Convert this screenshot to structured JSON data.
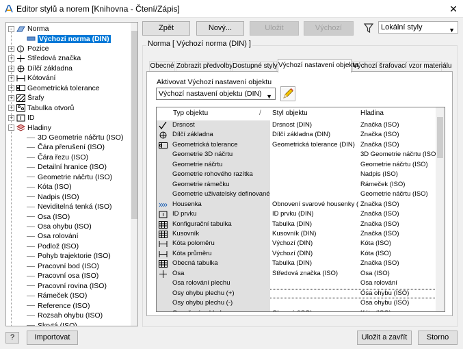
{
  "window": {
    "title": "Editor stylů a norem [Knihovna - Čtení/Zápis]",
    "close": "✕"
  },
  "tree": [
    {
      "label": "Norma",
      "level": 0,
      "exp": "-",
      "icon": "norm"
    },
    {
      "label": "Výchozí norma (DIN)",
      "level": 1,
      "icon": "norm-child",
      "selected": true
    },
    {
      "label": "Pozice",
      "level": 0,
      "exp": "+",
      "icon": "balloon"
    },
    {
      "label": "Středová značka",
      "level": 0,
      "exp": "+",
      "icon": "centermark"
    },
    {
      "label": "Dílčí základna",
      "level": 0,
      "exp": "+",
      "icon": "datum"
    },
    {
      "label": "Kótování",
      "level": 0,
      "exp": "+",
      "icon": "dimension"
    },
    {
      "label": "Geometrická tolerance",
      "level": 0,
      "exp": "+",
      "icon": "gtol"
    },
    {
      "label": "Šrafy",
      "level": 0,
      "exp": "+",
      "icon": "hatch"
    },
    {
      "label": "Tabulka otvorů",
      "level": 0,
      "exp": "+",
      "icon": "holetable"
    },
    {
      "label": "ID",
      "level": 0,
      "exp": "+",
      "icon": "id"
    },
    {
      "label": "Hladiny",
      "level": 0,
      "exp": "-",
      "icon": "layers"
    },
    {
      "label": "3D Geometrie náčrtu (ISO)",
      "level": 1
    },
    {
      "label": "Čára přerušení (ISO)",
      "level": 1
    },
    {
      "label": "Čára řezu (ISO)",
      "level": 1
    },
    {
      "label": "Detailní hranice (ISO)",
      "level": 1
    },
    {
      "label": "Geometrie náčrtu (ISO)",
      "level": 1
    },
    {
      "label": "Kóta (ISO)",
      "level": 1
    },
    {
      "label": "Nadpis (ISO)",
      "level": 1
    },
    {
      "label": "Neviditelná tenká (ISO)",
      "level": 1
    },
    {
      "label": "Osa (ISO)",
      "level": 1
    },
    {
      "label": "Osa ohybu (ISO)",
      "level": 1
    },
    {
      "label": "Osa rolování",
      "level": 1
    },
    {
      "label": "Podlož (ISO)",
      "level": 1
    },
    {
      "label": "Pohyb trajektorie (ISO)",
      "level": 1
    },
    {
      "label": "Pracovní bod (ISO)",
      "level": 1
    },
    {
      "label": "Pracovní osa (ISO)",
      "level": 1
    },
    {
      "label": "Pracovní rovina (ISO)",
      "level": 1
    },
    {
      "label": "Rámeček (ISO)",
      "level": 1
    },
    {
      "label": "Reference (ISO)",
      "level": 1
    },
    {
      "label": "Rozsah ohybu (ISO)",
      "level": 1
    },
    {
      "label": "Skrytá (ISO)",
      "level": 1
    }
  ],
  "toolbar": {
    "back": "Zpět",
    "new": "Nový...",
    "save": "Uložit",
    "default": "Výchozí",
    "filter": "Lokální styly"
  },
  "group_title": "Norma [ Výchozí norma (DIN) ]",
  "tabs": [
    "Obecné",
    "Zobrazit předvolby",
    "Dostupné styly",
    "Výchozí nastavení objektu",
    "Výchozí šrafovací vzor materiálu"
  ],
  "active_tab": 3,
  "object_defaults": {
    "label": "Aktivovat Výchozí nastavení objektu",
    "value": "Výchozí nastavení objektu (DIN)"
  },
  "grid": {
    "headers": [
      "Typ objektu",
      "Styl objektu",
      "Hladina"
    ],
    "sort_icon": "/",
    "rows": [
      {
        "type": "Drsnost",
        "style": "Drsnost (DIN)",
        "layer": "Značka (ISO)",
        "icon": "check"
      },
      {
        "type": "Dílčí základna",
        "style": "Dílčí základna (DIN)",
        "layer": "Značka (ISO)",
        "icon": "datum"
      },
      {
        "type": "Geometrická tolerance",
        "style": "Geometrická tolerance (DIN)",
        "layer": "Značka (ISO)",
        "icon": "gtol"
      },
      {
        "type": "Geometrie 3D náčrtu",
        "style": "",
        "layer": "3D Geometrie náčrtu (ISO)",
        "icon": ""
      },
      {
        "type": "Geometrie náčrtu",
        "style": "",
        "layer": "Geometrie náčrtu (ISO)",
        "icon": ""
      },
      {
        "type": "Geometrie rohového razítka",
        "style": "",
        "layer": "Nadpis (ISO)",
        "icon": ""
      },
      {
        "type": "Geometrie rámečku",
        "style": "",
        "layer": "Rámeček (ISO)",
        "icon": ""
      },
      {
        "type": "Geometrie uživatelsky definované zn",
        "style": "",
        "layer": "Geometrie náčrtu (ISO)",
        "icon": ""
      },
      {
        "type": "Housenka",
        "style": "Obnovení svarové housenky (IS",
        "layer": "Značka (ISO)",
        "icon": "weld"
      },
      {
        "type": "ID prvku",
        "style": "ID prvku (DIN)",
        "layer": "Značka (ISO)",
        "icon": "id"
      },
      {
        "type": "Konfigurační tabulka",
        "style": "Tabulka (DIN)",
        "layer": "Značka (ISO)",
        "icon": "table"
      },
      {
        "type": "Kusovník",
        "style": "Kusovník (DIN)",
        "layer": "Značka (ISO)",
        "icon": "table"
      },
      {
        "type": "Kóta poloměru",
        "style": "Výchozí (DIN)",
        "layer": "Kóta (ISO)",
        "icon": "dimension"
      },
      {
        "type": "Kóta průměru",
        "style": "Výchozí (DIN)",
        "layer": "Kóta (ISO)",
        "icon": "dimension"
      },
      {
        "type": "Obecná tabulka",
        "style": "Tabulka (DIN)",
        "layer": "Značka (ISO)",
        "icon": "table"
      },
      {
        "type": "Osa",
        "style": "Středová značka (ISO)",
        "layer": "Osa (ISO)",
        "icon": "centermark"
      },
      {
        "type": "Osa rolování plechu",
        "style": "",
        "layer": "Osa rolování",
        "icon": ""
      },
      {
        "type": "Osy ohybu plechu (+)",
        "style": "",
        "layer": "Osa ohybu (ISO)",
        "icon": "",
        "focus": true
      },
      {
        "type": "Osy ohybu plechu (-)",
        "style": "",
        "layer": "Osa ohybu (ISO)",
        "icon": ""
      },
      {
        "type": "Označení pohledu",
        "style": "Obecné (ISO)",
        "layer": "Kóta (ISO)",
        "icon": "view"
      }
    ]
  },
  "footer": {
    "help": "?",
    "import": "Importovat",
    "save_close": "Uložit a zavřít",
    "cancel": "Storno"
  }
}
